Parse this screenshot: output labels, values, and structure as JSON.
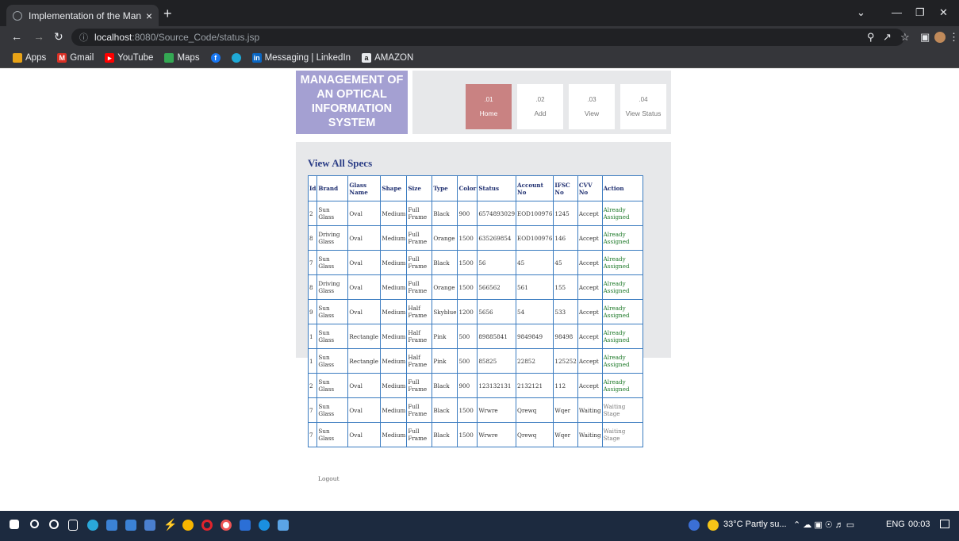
{
  "browser": {
    "tab_title": "Implementation of the Managem",
    "tab_close": "×",
    "new_tab": "+",
    "url_host": "localhost",
    "url_path": ":8080/Source_Code/status.jsp",
    "bookmarks": [
      "Apps",
      "Gmail",
      "YouTube",
      "Maps",
      "Messaging | LinkedIn",
      "AMAZON"
    ]
  },
  "logo": {
    "line1": "MANAGEMENT OF",
    "line2": "AN OPTICAL",
    "line3": "INFORMATION",
    "line4": "SYSTEM"
  },
  "nav": [
    {
      "num": ".01",
      "label": "Home"
    },
    {
      "num": ".02",
      "label": "Add"
    },
    {
      "num": ".03",
      "label": "View"
    },
    {
      "num": ".04",
      "label": "View Status"
    }
  ],
  "heading": "View All Specs",
  "table": {
    "headers": [
      "Id",
      "Brand",
      "Glass Name",
      "Shape",
      "Size",
      "Type",
      "Color",
      "Status",
      "Account No",
      "IFSC No",
      "CVV No",
      "Action"
    ],
    "rows": [
      [
        "2",
        "Sun Glass",
        "Oval",
        "Medium",
        "Full Frame",
        "Black",
        "900",
        "6574893029",
        "EOD100976",
        "1245",
        "Accept",
        "Already Assigned"
      ],
      [
        "8",
        "Driving Glass",
        "Oval",
        "Medium",
        "Full Frame",
        "Orange",
        "1500",
        "635269854",
        "EOD100976",
        "146",
        "Accept",
        "Already Assigned"
      ],
      [
        "7",
        "Sun Glass",
        "Oval",
        "Medium",
        "Full Frame",
        "Black",
        "1500",
        "56",
        "45",
        "45",
        "Accept",
        "Already Assigned"
      ],
      [
        "8",
        "Driving Glass",
        "Oval",
        "Medium",
        "Full Frame",
        "Orange",
        "1500",
        "566562",
        "561",
        "155",
        "Accept",
        "Already Assigned"
      ],
      [
        "9",
        "Sun Glass",
        "Oval",
        "Medium",
        "Half Frame",
        "Skyblue",
        "1200",
        "5656",
        "54",
        "533",
        "Accept",
        "Already Assigned"
      ],
      [
        "1",
        "Sun Glass",
        "Rectangle",
        "Medium",
        "Half Frame",
        "Pink",
        "500",
        "89885841",
        "9849849",
        "98498",
        "Accept",
        "Already Assigned"
      ],
      [
        "1",
        "Sun Glass",
        "Rectangle",
        "Medium",
        "Half Frame",
        "Pink",
        "500",
        "85825",
        "22852",
        "125252",
        "Accept",
        "Already Assigned"
      ],
      [
        "2",
        "Sun Glass",
        "Oval",
        "Medium",
        "Full Frame",
        "Black",
        "900",
        "123132131",
        "2132121",
        "112",
        "Accept",
        "Already Assigned"
      ],
      [
        "7",
        "Sun Glass",
        "Oval",
        "Medium",
        "Full Frame",
        "Black",
        "1500",
        "Wrwre",
        "Qrewq",
        "Wqer",
        "Waiting",
        "Waiting Stage"
      ],
      [
        "7",
        "Sun Glass",
        "Oval",
        "Medium",
        "Full Frame",
        "Black",
        "1500",
        "Wrwre",
        "Qrewq",
        "Wqer",
        "Waiting",
        "Waiting Stage"
      ]
    ]
  },
  "logout": "Logout",
  "taskbar": {
    "weather": "33°C Partly su...",
    "lang": "ENG",
    "time": "00:03"
  },
  "colors": {
    "logo_bg": "#a4a0d2",
    "active_nav": "#c98282",
    "table_border": "#3b7cc0",
    "heading": "#2b3d86"
  }
}
